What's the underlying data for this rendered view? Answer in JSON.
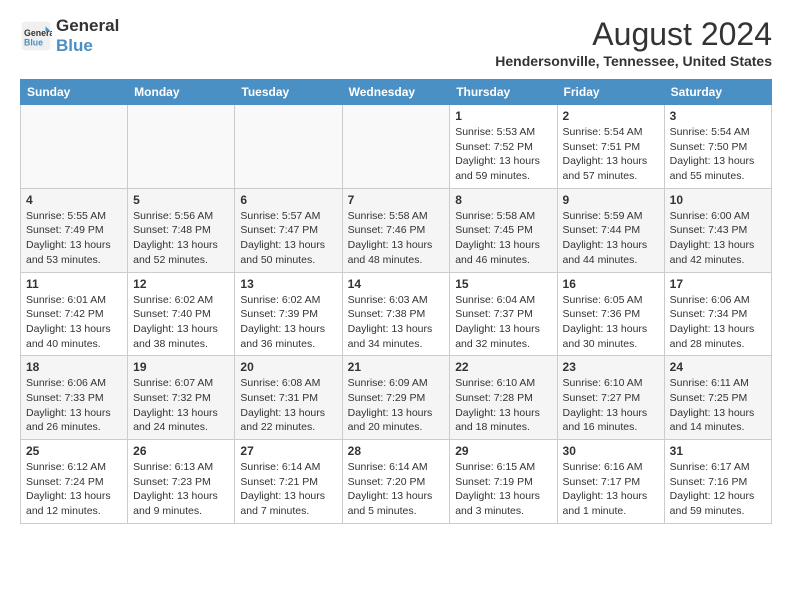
{
  "header": {
    "logo_line1": "General",
    "logo_line2": "Blue",
    "month_year": "August 2024",
    "location": "Hendersonville, Tennessee, United States"
  },
  "calendar": {
    "days_of_week": [
      "Sunday",
      "Monday",
      "Tuesday",
      "Wednesday",
      "Thursday",
      "Friday",
      "Saturday"
    ],
    "weeks": [
      [
        {
          "num": "",
          "detail": ""
        },
        {
          "num": "",
          "detail": ""
        },
        {
          "num": "",
          "detail": ""
        },
        {
          "num": "",
          "detail": ""
        },
        {
          "num": "1",
          "detail": "Sunrise: 5:53 AM\nSunset: 7:52 PM\nDaylight: 13 hours\nand 59 minutes."
        },
        {
          "num": "2",
          "detail": "Sunrise: 5:54 AM\nSunset: 7:51 PM\nDaylight: 13 hours\nand 57 minutes."
        },
        {
          "num": "3",
          "detail": "Sunrise: 5:54 AM\nSunset: 7:50 PM\nDaylight: 13 hours\nand 55 minutes."
        }
      ],
      [
        {
          "num": "4",
          "detail": "Sunrise: 5:55 AM\nSunset: 7:49 PM\nDaylight: 13 hours\nand 53 minutes."
        },
        {
          "num": "5",
          "detail": "Sunrise: 5:56 AM\nSunset: 7:48 PM\nDaylight: 13 hours\nand 52 minutes."
        },
        {
          "num": "6",
          "detail": "Sunrise: 5:57 AM\nSunset: 7:47 PM\nDaylight: 13 hours\nand 50 minutes."
        },
        {
          "num": "7",
          "detail": "Sunrise: 5:58 AM\nSunset: 7:46 PM\nDaylight: 13 hours\nand 48 minutes."
        },
        {
          "num": "8",
          "detail": "Sunrise: 5:58 AM\nSunset: 7:45 PM\nDaylight: 13 hours\nand 46 minutes."
        },
        {
          "num": "9",
          "detail": "Sunrise: 5:59 AM\nSunset: 7:44 PM\nDaylight: 13 hours\nand 44 minutes."
        },
        {
          "num": "10",
          "detail": "Sunrise: 6:00 AM\nSunset: 7:43 PM\nDaylight: 13 hours\nand 42 minutes."
        }
      ],
      [
        {
          "num": "11",
          "detail": "Sunrise: 6:01 AM\nSunset: 7:42 PM\nDaylight: 13 hours\nand 40 minutes."
        },
        {
          "num": "12",
          "detail": "Sunrise: 6:02 AM\nSunset: 7:40 PM\nDaylight: 13 hours\nand 38 minutes."
        },
        {
          "num": "13",
          "detail": "Sunrise: 6:02 AM\nSunset: 7:39 PM\nDaylight: 13 hours\nand 36 minutes."
        },
        {
          "num": "14",
          "detail": "Sunrise: 6:03 AM\nSunset: 7:38 PM\nDaylight: 13 hours\nand 34 minutes."
        },
        {
          "num": "15",
          "detail": "Sunrise: 6:04 AM\nSunset: 7:37 PM\nDaylight: 13 hours\nand 32 minutes."
        },
        {
          "num": "16",
          "detail": "Sunrise: 6:05 AM\nSunset: 7:36 PM\nDaylight: 13 hours\nand 30 minutes."
        },
        {
          "num": "17",
          "detail": "Sunrise: 6:06 AM\nSunset: 7:34 PM\nDaylight: 13 hours\nand 28 minutes."
        }
      ],
      [
        {
          "num": "18",
          "detail": "Sunrise: 6:06 AM\nSunset: 7:33 PM\nDaylight: 13 hours\nand 26 minutes."
        },
        {
          "num": "19",
          "detail": "Sunrise: 6:07 AM\nSunset: 7:32 PM\nDaylight: 13 hours\nand 24 minutes."
        },
        {
          "num": "20",
          "detail": "Sunrise: 6:08 AM\nSunset: 7:31 PM\nDaylight: 13 hours\nand 22 minutes."
        },
        {
          "num": "21",
          "detail": "Sunrise: 6:09 AM\nSunset: 7:29 PM\nDaylight: 13 hours\nand 20 minutes."
        },
        {
          "num": "22",
          "detail": "Sunrise: 6:10 AM\nSunset: 7:28 PM\nDaylight: 13 hours\nand 18 minutes."
        },
        {
          "num": "23",
          "detail": "Sunrise: 6:10 AM\nSunset: 7:27 PM\nDaylight: 13 hours\nand 16 minutes."
        },
        {
          "num": "24",
          "detail": "Sunrise: 6:11 AM\nSunset: 7:25 PM\nDaylight: 13 hours\nand 14 minutes."
        }
      ],
      [
        {
          "num": "25",
          "detail": "Sunrise: 6:12 AM\nSunset: 7:24 PM\nDaylight: 13 hours\nand 12 minutes."
        },
        {
          "num": "26",
          "detail": "Sunrise: 6:13 AM\nSunset: 7:23 PM\nDaylight: 13 hours\nand 9 minutes."
        },
        {
          "num": "27",
          "detail": "Sunrise: 6:14 AM\nSunset: 7:21 PM\nDaylight: 13 hours\nand 7 minutes."
        },
        {
          "num": "28",
          "detail": "Sunrise: 6:14 AM\nSunset: 7:20 PM\nDaylight: 13 hours\nand 5 minutes."
        },
        {
          "num": "29",
          "detail": "Sunrise: 6:15 AM\nSunset: 7:19 PM\nDaylight: 13 hours\nand 3 minutes."
        },
        {
          "num": "30",
          "detail": "Sunrise: 6:16 AM\nSunset: 7:17 PM\nDaylight: 13 hours\nand 1 minute."
        },
        {
          "num": "31",
          "detail": "Sunrise: 6:17 AM\nSunset: 7:16 PM\nDaylight: 12 hours\nand 59 minutes."
        }
      ]
    ]
  }
}
